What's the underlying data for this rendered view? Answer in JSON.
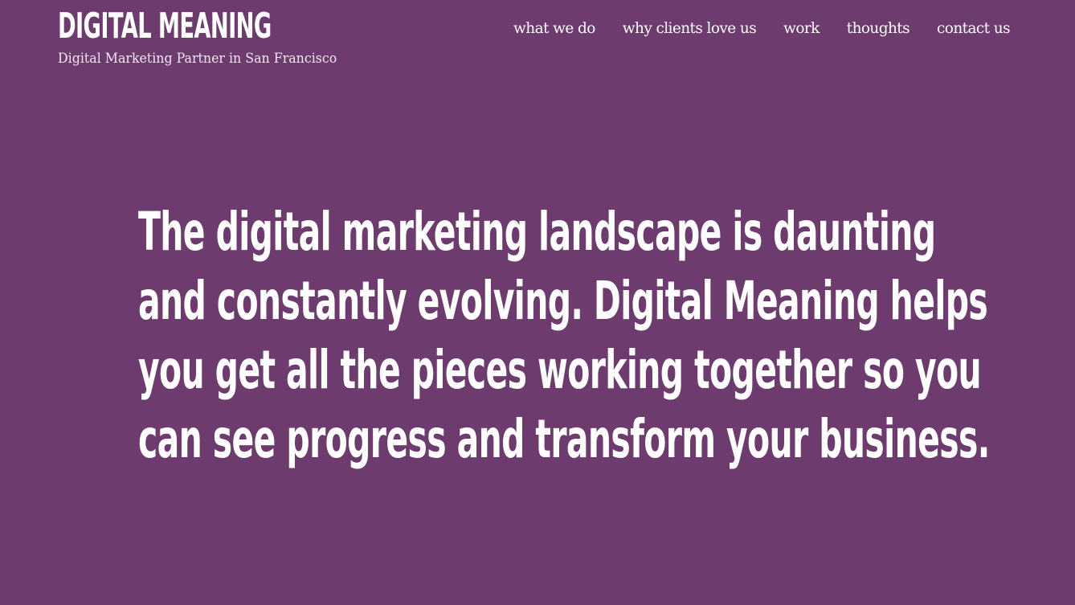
{
  "brand": {
    "title": "DIGITAL MEANING",
    "tagline": "Digital Marketing Partner in San Francisco"
  },
  "nav": {
    "items": [
      {
        "label": "what we do"
      },
      {
        "label": "why clients love us"
      },
      {
        "label": "work"
      },
      {
        "label": "thoughts"
      },
      {
        "label": "contact us"
      }
    ]
  },
  "hero": {
    "text": "The digital marketing landscape is daunting and constantly evolving. Digital Meaning helps you get all the pieces working together so you can see progress and transform your business."
  },
  "colors": {
    "background": "#6d3b6d",
    "text": "#ffffff"
  }
}
